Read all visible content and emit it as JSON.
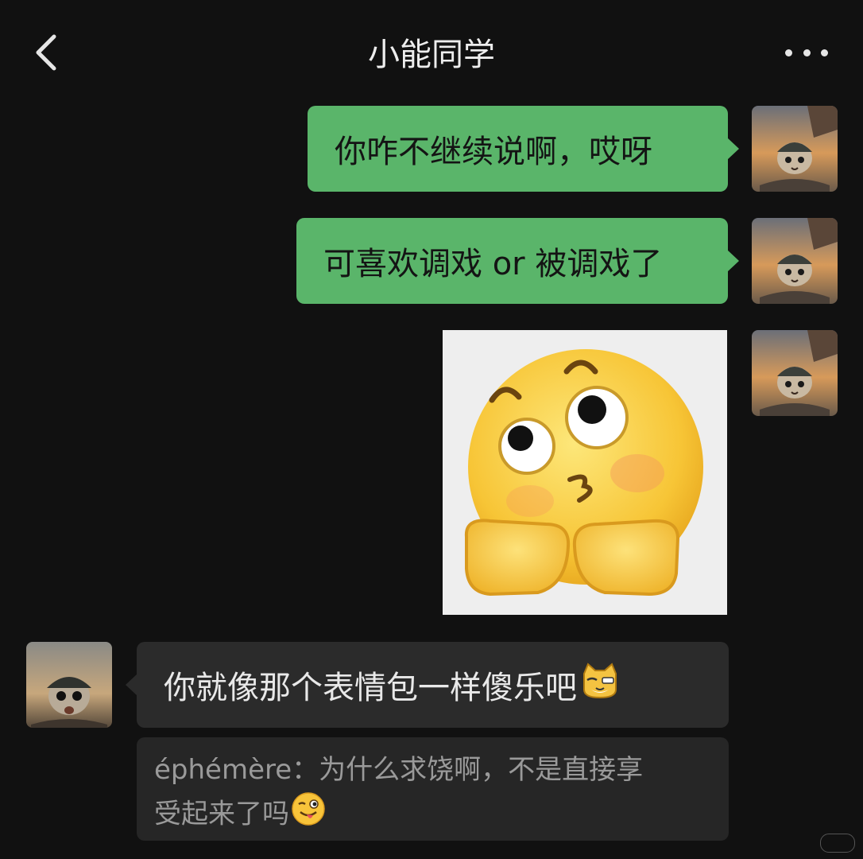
{
  "header": {
    "title": "小能同学",
    "back_icon": "chevron-left-icon",
    "more_icon": "more-dots-icon"
  },
  "messages": [
    {
      "side": "right",
      "type": "text",
      "text": "你咋不继续说啊，哎呀"
    },
    {
      "side": "right",
      "type": "text",
      "text": "可喜欢调戏 or 被调戏了"
    },
    {
      "side": "right",
      "type": "sticker",
      "sticker": "shy-peeking-emoji-sticker"
    },
    {
      "side": "left",
      "type": "text",
      "text": "你就像那个表情包一样傻乐吧",
      "trailing_emoji": "cat-face-emoji"
    }
  ],
  "quote": {
    "author": "éphémère：",
    "text_line1": "为什么求饶啊，不是直接享",
    "text_line2": "受起来了吗",
    "trailing_emoji": "winking-tongue-emoji"
  },
  "colors": {
    "background": "#111111",
    "outgoing_bubble": "#5ab56a",
    "incoming_bubble": "#2b2b2b",
    "quote_bg": "#262626"
  }
}
